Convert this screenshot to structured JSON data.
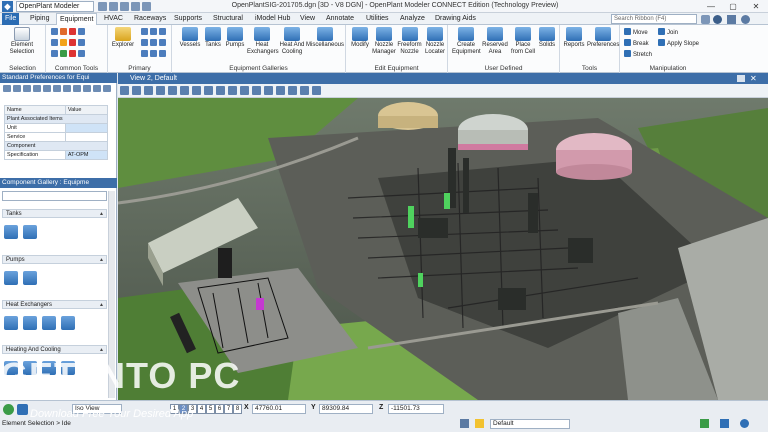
{
  "titlebar": {
    "workspace": "OpenPlant Modeler",
    "title": "OpenPlantSIG-201705.dgn [3D - V8 DGN] - OpenPlant Modeler CONNECT Edition (Technology Preview)",
    "minimize": "—",
    "maximize": "▢",
    "close": "✕"
  },
  "ribbon_tabs": [
    "File",
    "Piping",
    "Equipment",
    "HVAC",
    "Raceways",
    "Supports",
    "Structural",
    "iModel Hub",
    "View",
    "Annotate",
    "Utilities",
    "Analyze",
    "Drawing Aids"
  ],
  "active_tab": "Equipment",
  "search": {
    "placeholder": "Search Ribbon (F4)"
  },
  "groups": {
    "selection": {
      "label": "Selection",
      "element_selection": "Element Selection"
    },
    "common_tools": {
      "label": "Common Tools"
    },
    "primary": {
      "label": "Primary",
      "explorer": "Explorer"
    },
    "equipment_galleries": {
      "label": "Equipment Galleries",
      "items": [
        "Vessels",
        "Tanks",
        "Pumps",
        "Heat Exchangers",
        "Heat And Cooling",
        "Miscellaneous"
      ]
    },
    "edit_equipment": {
      "label": "Edit Equipment",
      "items": [
        "Modify",
        "Nozzle Manager",
        "Freeform Nozzle",
        "Nozzle Locater"
      ]
    },
    "user_defined": {
      "label": "User Defined",
      "items": [
        "Create Equipment",
        "Reserved Area",
        "Place from Cell",
        "Solids"
      ]
    },
    "tools": {
      "label": "Tools",
      "items": [
        "Reports",
        "Preferences"
      ]
    },
    "manipulation": {
      "label": "Manipulation",
      "items": [
        "Move",
        "Join",
        "Break",
        "Apply Slope",
        "Stretch"
      ]
    }
  },
  "left_panel": {
    "prefs_title": "Standard Preferences for Equi",
    "table": {
      "headers": [
        "Name",
        "Value"
      ],
      "rows": [
        {
          "type": "section",
          "name": "Plant Associated Items",
          "value": ""
        },
        {
          "type": "row",
          "name": "Unit",
          "value": ""
        },
        {
          "type": "row",
          "name": "Service",
          "value": ""
        },
        {
          "type": "section",
          "name": "Component",
          "value": ""
        },
        {
          "type": "row",
          "name": "Specification",
          "value": "AT-OPM"
        }
      ]
    },
    "gallery_title": "Component Gallery : Equipme",
    "sections": [
      "Tanks",
      "Pumps",
      "Heat Exchangers",
      "Heating And Cooling"
    ]
  },
  "view": {
    "title": "View 2, Default"
  },
  "status": {
    "view_select": "Iso View",
    "view_numbers": [
      "1",
      "2",
      "3",
      "4",
      "5",
      "6",
      "7",
      "8"
    ],
    "x_label": "X",
    "x_value": "47760.01",
    "y_label": "Y",
    "y_value": "89309.84",
    "z_label": "Z",
    "z_value": "-11501.73",
    "prompt": "Element Selection > Ide",
    "level": "Default"
  },
  "watermark": {
    "text": "GET INTO PC",
    "subtext": "Download Free Your Desired App"
  },
  "colors": {
    "accent": "#2b6cb3",
    "panel_header": "#3d6ea8"
  }
}
